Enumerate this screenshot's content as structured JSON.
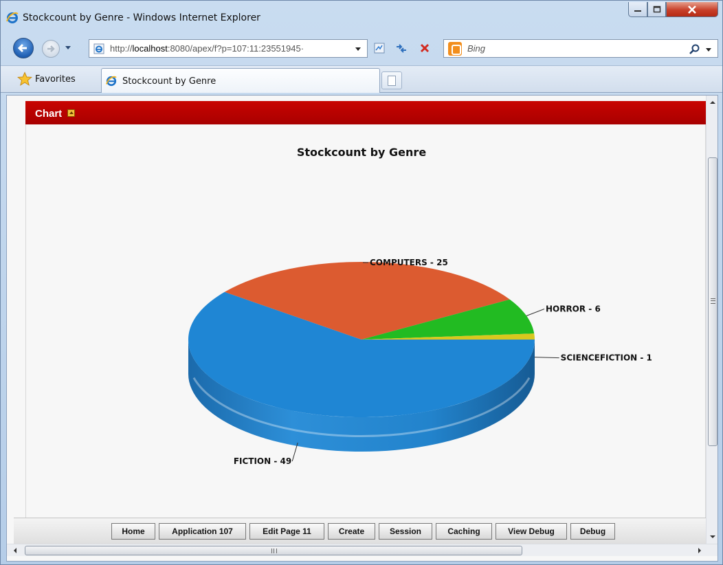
{
  "window": {
    "title": "Stockcount by Genre - Windows Internet Explorer",
    "icon": "ie-logo-icon"
  },
  "address_bar": {
    "url_prefix": "http://",
    "url_host": "localhost",
    "url_rest": ":8080/apex/f?p=107:11:23551945·",
    "page_icon": "ie-page-icon"
  },
  "search": {
    "placeholder": "Bing",
    "provider_icon": "bing-icon"
  },
  "favorites": {
    "label": "Favorites",
    "icon": "star-icon"
  },
  "tabs": [
    {
      "label": "Stockcount by Genre",
      "icon": "ie-logo-icon",
      "active": true
    }
  ],
  "region": {
    "title": "Chart",
    "collapse_icon": "collapse-icon",
    "header_color": "#b80200"
  },
  "chart_data": {
    "type": "pie",
    "title": "Stockcount by Genre",
    "slices": [
      {
        "label": "FICTION - 49",
        "name": "FICTION",
        "value": 49,
        "color": "#1f86d4"
      },
      {
        "label": "COMPUTERS - 25",
        "name": "COMPUTERS",
        "value": 25,
        "color": "#dc5b30"
      },
      {
        "label": "HORROR - 6",
        "name": "HORROR",
        "value": 6,
        "color": "#22bb22"
      },
      {
        "label": "SCIENCEFICTION - 1",
        "name": "SCIENCEFICTION",
        "value": 1,
        "color": "#d8c81e"
      }
    ],
    "style": "3d",
    "legend": "none"
  },
  "dev_toolbar": {
    "buttons": [
      "Home",
      "Application 107",
      "Edit Page 11",
      "Create",
      "Session",
      "Caching",
      "View Debug",
      "Debug"
    ]
  }
}
